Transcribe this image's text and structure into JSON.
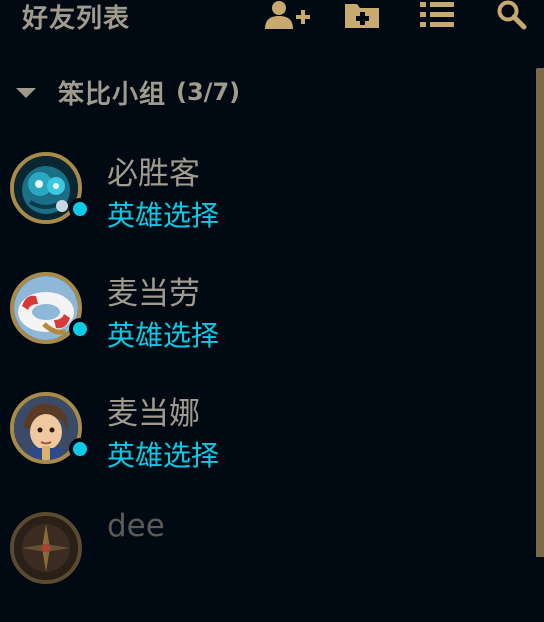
{
  "header": {
    "title": "好友列表",
    "icons": [
      "add-friend-icon",
      "add-folder-icon",
      "list-view-icon",
      "search-icon"
    ]
  },
  "group": {
    "name": "笨比小组",
    "count": "(3/7)"
  },
  "friends": [
    {
      "name": "必胜客",
      "status": "英雄选择",
      "online": true,
      "avatar": "blue-creature-avatar"
    },
    {
      "name": "麦当劳",
      "status": "英雄选择",
      "online": true,
      "avatar": "life-ring-avatar"
    },
    {
      "name": "麦当娜",
      "status": "英雄选择",
      "online": true,
      "avatar": "champion-portrait-avatar"
    },
    {
      "name": "dee",
      "status": "",
      "online": false,
      "avatar": "compass-avatar"
    }
  ],
  "colors": {
    "background": "#010a13",
    "gold_text": "#a09b8c",
    "status_blue": "#0acbe6",
    "frame_gold": "#a88a4a",
    "icon_gold": "#c8aa6e"
  }
}
